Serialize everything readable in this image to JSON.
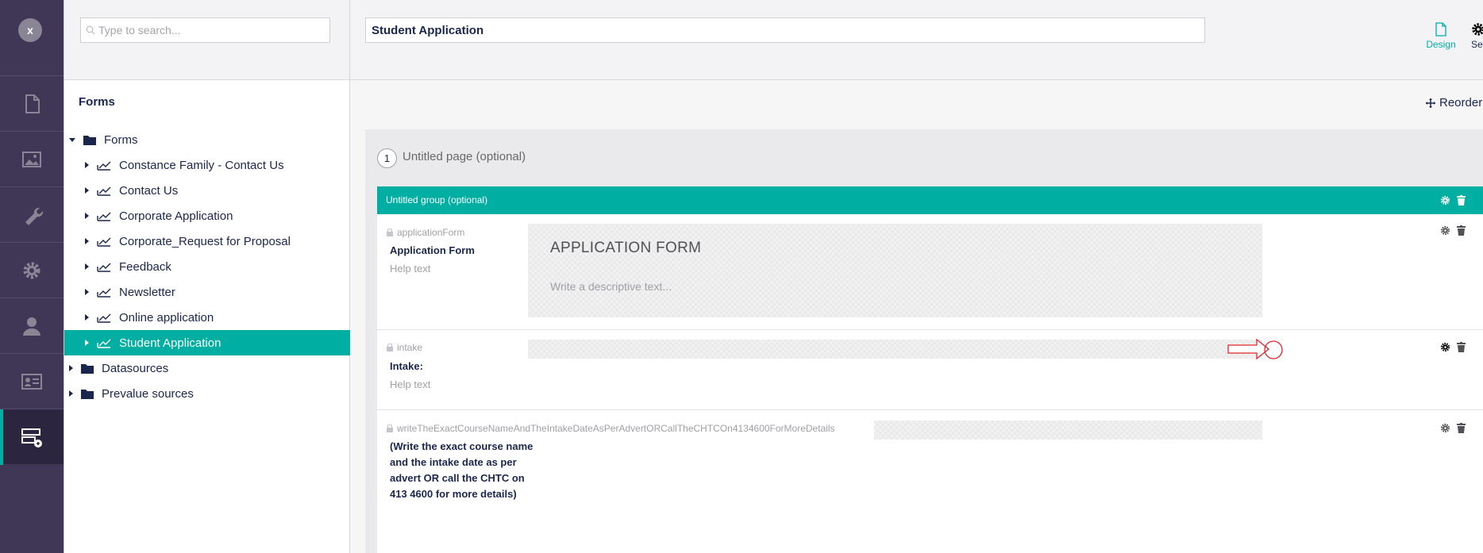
{
  "rail": {
    "close_label": "x",
    "sections": [
      {
        "icon": "content-icon"
      },
      {
        "icon": "media-icon"
      },
      {
        "icon": "settings-wrench-icon"
      },
      {
        "icon": "developer-gear-icon"
      },
      {
        "icon": "users-icon"
      },
      {
        "icon": "members-icon"
      },
      {
        "icon": "forms-icon",
        "active": true
      }
    ]
  },
  "tree": {
    "search_placeholder": "Type to search...",
    "title": "Forms",
    "root": "Forms",
    "items": [
      {
        "label": "Constance Family - Contact Us"
      },
      {
        "label": "Contact Us"
      },
      {
        "label": "Corporate Application"
      },
      {
        "label": "Corporate_Request for Proposal"
      },
      {
        "label": "Feedback"
      },
      {
        "label": "Newsletter"
      },
      {
        "label": "Online application"
      },
      {
        "label": "Student Application",
        "selected": true
      }
    ],
    "other_roots": [
      "Datasources",
      "Prevalue sources"
    ]
  },
  "header": {
    "form_name": "Student Application",
    "design_label": "Design",
    "settings_label": "Settings"
  },
  "main": {
    "reorder_label": "Reorder",
    "page_number": "1",
    "page_title": "Untitled page (optional)",
    "group_title": "Untitled group (optional)",
    "fields": [
      {
        "alias": "applicationForm",
        "label": "Application Form",
        "help": "Help text",
        "heading": "APPLICATION FORM",
        "description_placeholder": "Write a descriptive text..."
      },
      {
        "alias": "intake",
        "label": "Intake:",
        "help": "Help text"
      },
      {
        "alias": "writeTheExactCourseNameAndTheIntakeDateAsPerAdvertORCallTheCHTCOn4134600ForMoreDetails",
        "label": "(Write the exact course name and the intake date as per advert OR call the CHTC on 413 4600 for more details)"
      }
    ]
  },
  "colors": {
    "accent": "#00aea2",
    "rail": "#403756",
    "text": "#1b264f",
    "annotation": "#e0262e"
  }
}
